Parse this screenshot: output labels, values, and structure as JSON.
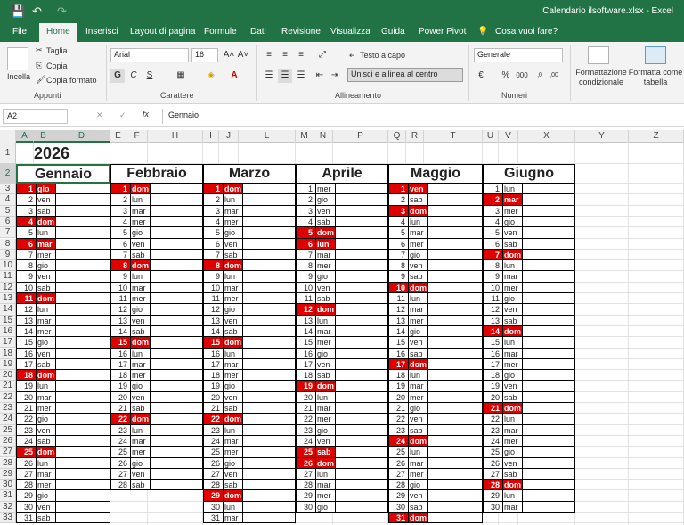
{
  "window": {
    "title": "Calendario ilsoftware.xlsx - Excel"
  },
  "quick_access": {
    "save_icon": "💾",
    "undo_icon": "↶",
    "redo_icon": "↷"
  },
  "tabs": [
    "File",
    "Home",
    "Inserisci",
    "Layout di pagina",
    "Formule",
    "Dati",
    "Revisione",
    "Visualizza",
    "Guida",
    "Power Pivot",
    "Cosa vuoi fare?"
  ],
  "ribbon": {
    "groups": {
      "clipboard": "Appunti",
      "font": "Carattere",
      "alignment": "Allineamento",
      "number": "Numeri"
    },
    "clipboard": {
      "paste": "Incolla",
      "cut": "Taglia",
      "copy": "Copia",
      "format_painter": "Copia formato"
    },
    "font": {
      "name": "Arial",
      "size": "16"
    },
    "alignment": {
      "wrap": "Testo a capo",
      "merge": "Unisci e allinea al centro"
    },
    "number": {
      "format": "Generale"
    },
    "styles": {
      "conditional": "Formattazione condizionale",
      "table": "Formatta come tabella"
    }
  },
  "formula_bar": {
    "name_box": "A2",
    "formula": "Gennaio"
  },
  "columns": [
    "A",
    "B",
    "D",
    "E",
    "F",
    "H",
    "I",
    "J",
    "L",
    "M",
    "N",
    "P",
    "Q",
    "R",
    "T",
    "U",
    "V",
    "X",
    "Y",
    "Z"
  ],
  "rows": [
    "1",
    "2",
    "3",
    "4",
    "5",
    "6",
    "7",
    "8",
    "9",
    "10",
    "11",
    "12",
    "13",
    "14",
    "15",
    "16",
    "17",
    "18",
    "19",
    "20",
    "21",
    "22",
    "23",
    "24",
    "25",
    "26",
    "27",
    "28",
    "29",
    "30",
    "31",
    "32",
    "33"
  ],
  "sheet": {
    "year": "2026",
    "months": [
      {
        "name": "Gennaio",
        "days": [
          "gio",
          "ven",
          "sab",
          "dom",
          "lun",
          "mar",
          "mer",
          "gio",
          "ven",
          "sab",
          "dom",
          "lun",
          "mar",
          "mer",
          "gio",
          "ven",
          "sab",
          "dom",
          "lun",
          "mar",
          "mer",
          "gio",
          "ven",
          "sab",
          "dom",
          "lun",
          "mar",
          "mer",
          "gio",
          "ven",
          "sab"
        ],
        "holidays": [
          1,
          4,
          6,
          11,
          18,
          25
        ]
      },
      {
        "name": "Febbraio",
        "days": [
          "dom",
          "lun",
          "mar",
          "mer",
          "gio",
          "ven",
          "sab",
          "dom",
          "lun",
          "mar",
          "mer",
          "gio",
          "ven",
          "sab",
          "dom",
          "lun",
          "mar",
          "mer",
          "gio",
          "ven",
          "sab",
          "dom",
          "lun",
          "mar",
          "mer",
          "gio",
          "ven",
          "sab"
        ],
        "holidays": [
          1,
          8,
          15,
          22
        ]
      },
      {
        "name": "Marzo",
        "days": [
          "dom",
          "lun",
          "mar",
          "mer",
          "gio",
          "ven",
          "sab",
          "dom",
          "lun",
          "mar",
          "mer",
          "gio",
          "ven",
          "sab",
          "dom",
          "lun",
          "mar",
          "mer",
          "gio",
          "ven",
          "sab",
          "dom",
          "lun",
          "mar",
          "mer",
          "gio",
          "ven",
          "sab",
          "dom",
          "lun",
          "mar"
        ],
        "holidays": [
          1,
          8,
          15,
          22,
          29
        ]
      },
      {
        "name": "Aprile",
        "days": [
          "mer",
          "gio",
          "ven",
          "sab",
          "dom",
          "lun",
          "mar",
          "mer",
          "gio",
          "ven",
          "sab",
          "dom",
          "lun",
          "mar",
          "mer",
          "gio",
          "ven",
          "sab",
          "dom",
          "lun",
          "mar",
          "mer",
          "gio",
          "ven",
          "sab",
          "dom",
          "lun",
          "mar",
          "mer",
          "gio"
        ],
        "holidays": [
          5,
          6,
          12,
          19,
          25,
          26
        ]
      },
      {
        "name": "Maggio",
        "days": [
          "ven",
          "sab",
          "dom",
          "lun",
          "mar",
          "mer",
          "gio",
          "ven",
          "sab",
          "dom",
          "lun",
          "mar",
          "mer",
          "gio",
          "ven",
          "sab",
          "dom",
          "lun",
          "mar",
          "mer",
          "gio",
          "ven",
          "sab",
          "dom",
          "lun",
          "mar",
          "mer",
          "gio",
          "ven",
          "sab",
          "dom"
        ],
        "holidays": [
          1,
          3,
          10,
          17,
          24,
          31
        ]
      },
      {
        "name": "Giugno",
        "days": [
          "lun",
          "mar",
          "mer",
          "gio",
          "ven",
          "sab",
          "dom",
          "lun",
          "mar",
          "mer",
          "gio",
          "ven",
          "sab",
          "dom",
          "lun",
          "mar",
          "mer",
          "gio",
          "ven",
          "sab",
          "dom",
          "lun",
          "mar",
          "mer",
          "gio",
          "ven",
          "sab",
          "dom",
          "lun",
          "mar"
        ],
        "holidays": [
          2,
          7,
          14,
          21,
          28
        ]
      }
    ]
  }
}
